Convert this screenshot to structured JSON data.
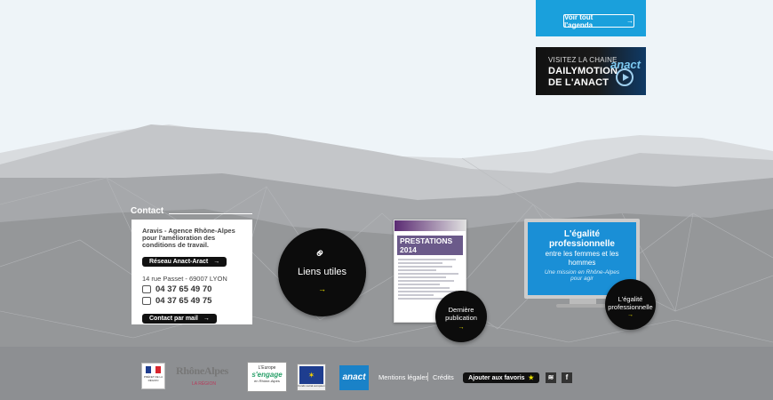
{
  "agenda": {
    "button_label": "Voir tout l'agenda",
    "arrow": "→"
  },
  "dailymotion": {
    "line1": "VISITEZ LA CHAINE",
    "line2": "DAILYMOTION",
    "line3": "DE L'ANACT",
    "logo_text": "anact"
  },
  "contact": {
    "title": "Contact",
    "org": "Aravis - Agence Rhône-Alpes pour l'amélioration des conditions de travail.",
    "network_button": "Réseau Anact-Aract",
    "address": "14 rue Passet - 69007 LYON",
    "phone": "04 37 65 49 70",
    "fax": "04 37 65 49 75",
    "mail_button": "Contact par mail",
    "arrow": "→"
  },
  "liens": {
    "label": "Liens utiles",
    "arrow": "→"
  },
  "publication": {
    "doc_title": "PRESTATIONS 2014",
    "label_1": "Dernière",
    "label_2": "publication",
    "arrow": "→"
  },
  "egalite_screen": {
    "title_1": "L'égalité",
    "title_2": "professionnelle",
    "sub_1": "entre les femmes et les",
    "sub_2": "hommes",
    "tag_1": "Une mission en Rhône-Alpes",
    "tag_2": "pour agir"
  },
  "egalite_circle": {
    "label_1": "L'égalité",
    "label_2": "professionnelle",
    "arrow": "→"
  },
  "logos": {
    "rf_text": "PRÉFET DE LA RÉGION",
    "ra_name": "RhôneAlpes",
    "ra_sub": "LA RÉGION",
    "eu1_t1": "L'Europe",
    "eu1_t2": "s'engage",
    "eu1_t3": "en Rhône-Alpes",
    "eu2_text": "Fonds social européen",
    "anact": "anact"
  },
  "footer": {
    "mentions": "Mentions légales",
    "credits": "Crédits",
    "favorites": "Ajouter aux favoris",
    "star": "★",
    "rss": "≋",
    "facebook": "f"
  },
  "colors": {
    "accent_blue": "#1aa0dc",
    "arrow_yellow": "#e8e000",
    "footer_gray": "#8e8e90"
  }
}
